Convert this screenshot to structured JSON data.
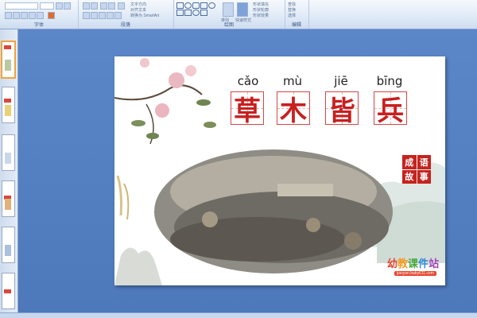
{
  "ribbon": {
    "groups": [
      {
        "label": "字体"
      },
      {
        "label": "段落"
      },
      {
        "label": "绘图"
      },
      {
        "label": "编辑"
      }
    ],
    "tiny_text": {
      "text_direction": "文字方向",
      "align_text": "对齐文本",
      "convert_smartart": "转换为 SmartArt",
      "arrange": "排列",
      "quick_styles": "快速样式",
      "shape_fill": "形状填充",
      "shape_outline": "形状轮廓",
      "shape_effects": "形状效果",
      "find": "查找",
      "replace": "替换",
      "select": "选择"
    }
  },
  "slide": {
    "pinyin": [
      "cǎo",
      "mù",
      "jiē",
      "bīng"
    ],
    "characters": [
      "草",
      "木",
      "皆",
      "兵"
    ],
    "seal_chars": [
      "成",
      "语",
      "故",
      "事"
    ],
    "logo_chars": [
      "幼",
      "教",
      "课",
      "件",
      "站"
    ],
    "logo_url": "jiaoyan.baby611.com"
  },
  "colors": {
    "title_red": "#c81f1f",
    "seal_red": "#c5231f",
    "workspace_blue": "#5b87c8"
  }
}
